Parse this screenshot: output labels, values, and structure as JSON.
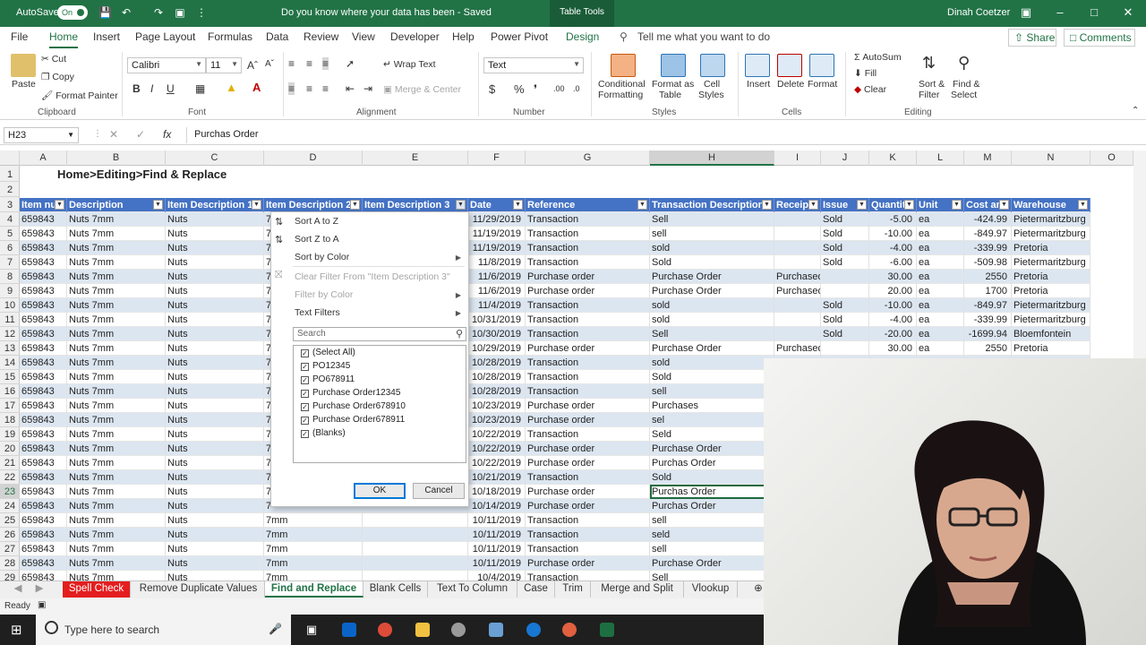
{
  "titlebar": {
    "autosave_label": "AutoSave",
    "autosave_state": "On",
    "doc_title": "Do you know where your data has been  -  Saved",
    "context_tab": "Table Tools",
    "user": "Dinah Coetzer"
  },
  "tabs": [
    "File",
    "Home",
    "Insert",
    "Page Layout",
    "Formulas",
    "Data",
    "Review",
    "View",
    "Developer",
    "Help",
    "Power Pivot",
    "Design"
  ],
  "tell_me": "Tell me what you want to do",
  "share_label": "Share",
  "comments_label": "Comments",
  "ribbon": {
    "clipboard": {
      "paste": "Paste",
      "cut": "Cut",
      "copy": "Copy",
      "format_painter": "Format Painter",
      "label": "Clipboard"
    },
    "font": {
      "name": "Calibri",
      "size": "11",
      "label": "Font"
    },
    "alignment": {
      "wrap": "Wrap Text",
      "merge": "Merge & Center",
      "label": "Alignment"
    },
    "number": {
      "format": "Text",
      "label": "Number"
    },
    "styles": {
      "conditional": "Conditional",
      "conditional2": "Formatting",
      "format_as": "Format as",
      "format_as2": "Table",
      "cell": "Cell",
      "cell2": "Styles",
      "label": "Styles"
    },
    "cells": {
      "insert": "Insert",
      "delete": "Delete",
      "format": "Format",
      "label": "Cells"
    },
    "editing": {
      "autosum": "AutoSum",
      "fill": "Fill",
      "clear": "Clear",
      "sort": "Sort &",
      "sort2": "Filter",
      "find": "Find &",
      "find2": "Select",
      "label": "Editing"
    }
  },
  "formula_bar": {
    "name_box": "H23",
    "value": "Purchas Order"
  },
  "columns": [
    "A",
    "B",
    "C",
    "D",
    "E",
    "F",
    "G",
    "H",
    "I",
    "J",
    "K",
    "L",
    "M",
    "N",
    "O"
  ],
  "page_title": "Home>Editing>Find & Replace",
  "table_headers": [
    "Item nu",
    "Description",
    "Item Description 1",
    "Item Description 2",
    "Item Description 3",
    "Date",
    "Reference",
    "Transaction Description",
    "Receipt",
    "Issue",
    "Quantit",
    "Unit",
    "Cost an",
    "Warehouse"
  ],
  "rows": [
    {
      "n": "4",
      "a": "659843",
      "b": "Nuts 7mm",
      "c": "Nuts",
      "d": "7",
      "f": "11/29/2019",
      "g": "Transaction",
      "h": "Sell",
      "i": "",
      "j": "Sold",
      "k": "-5.00",
      "l": "ea",
      "m": "-424.99",
      "wh": "Pietermaritzburg"
    },
    {
      "n": "5",
      "a": "659843",
      "b": "Nuts 7mm",
      "c": "Nuts",
      "d": "7",
      "f": "11/19/2019",
      "g": "Transaction",
      "h": "sell",
      "i": "",
      "j": "Sold",
      "k": "-10.00",
      "l": "ea",
      "m": "-849.97",
      "wh": "Pietermaritzburg"
    },
    {
      "n": "6",
      "a": "659843",
      "b": "Nuts 7mm",
      "c": "Nuts",
      "d": "7",
      "f": "11/19/2019",
      "g": "Transaction",
      "h": "sold",
      "i": "",
      "j": "Sold",
      "k": "-4.00",
      "l": "ea",
      "m": "-339.99",
      "wh": "Pretoria"
    },
    {
      "n": "7",
      "a": "659843",
      "b": "Nuts 7mm",
      "c": "Nuts",
      "d": "7",
      "f": "11/8/2019",
      "g": "Transaction",
      "h": "Sold",
      "i": "",
      "j": "Sold",
      "k": "-6.00",
      "l": "ea",
      "m": "-509.98",
      "wh": "Pietermaritzburg"
    },
    {
      "n": "8",
      "a": "659843",
      "b": "Nuts 7mm",
      "c": "Nuts",
      "d": "7",
      "f": "11/6/2019",
      "g": "Purchase order",
      "h": "Purchase Order",
      "i": "Purchased",
      "j": "",
      "k": "30.00",
      "l": "ea",
      "m": "2550",
      "wh": "Pretoria"
    },
    {
      "n": "9",
      "a": "659843",
      "b": "Nuts 7mm",
      "c": "Nuts",
      "d": "7",
      "f": "11/6/2019",
      "g": "Purchase order",
      "h": "Purchase Order",
      "i": "Purchased",
      "j": "",
      "k": "20.00",
      "l": "ea",
      "m": "1700",
      "wh": "Pretoria"
    },
    {
      "n": "10",
      "a": "659843",
      "b": "Nuts 7mm",
      "c": "Nuts",
      "d": "7",
      "f": "11/4/2019",
      "g": "Transaction",
      "h": "sold",
      "i": "",
      "j": "Sold",
      "k": "-10.00",
      "l": "ea",
      "m": "-849.97",
      "wh": "Pietermaritzburg"
    },
    {
      "n": "11",
      "a": "659843",
      "b": "Nuts 7mm",
      "c": "Nuts",
      "d": "7",
      "f": "10/31/2019",
      "g": "Transaction",
      "h": "sold",
      "i": "",
      "j": "Sold",
      "k": "-4.00",
      "l": "ea",
      "m": "-339.99",
      "wh": "Pietermaritzburg"
    },
    {
      "n": "12",
      "a": "659843",
      "b": "Nuts 7mm",
      "c": "Nuts",
      "d": "7",
      "f": "10/30/2019",
      "g": "Transaction",
      "h": "Sell",
      "i": "",
      "j": "Sold",
      "k": "-20.00",
      "l": "ea",
      "m": "-1699.94",
      "wh": "Bloemfontein"
    },
    {
      "n": "13",
      "a": "659843",
      "b": "Nuts 7mm",
      "c": "Nuts",
      "d": "7",
      "f": "10/29/2019",
      "g": "Purchase order",
      "h": "Purchase Order",
      "i": "Purchased",
      "j": "",
      "k": "30.00",
      "l": "ea",
      "m": "2550",
      "wh": "Pretoria"
    },
    {
      "n": "14",
      "a": "659843",
      "b": "Nuts 7mm",
      "c": "Nuts",
      "d": "7",
      "f": "10/28/2019",
      "g": "Transaction",
      "h": "sold",
      "i": "",
      "j": "",
      "k": "",
      "l": "",
      "m": "",
      "wh": ""
    },
    {
      "n": "15",
      "a": "659843",
      "b": "Nuts 7mm",
      "c": "Nuts",
      "d": "7",
      "f": "10/28/2019",
      "g": "Transaction",
      "h": "Sold",
      "i": "",
      "j": "",
      "k": "",
      "l": "",
      "m": "",
      "wh": ""
    },
    {
      "n": "16",
      "a": "659843",
      "b": "Nuts 7mm",
      "c": "Nuts",
      "d": "7",
      "f": "10/28/2019",
      "g": "Transaction",
      "h": "sell",
      "i": "",
      "j": "",
      "k": "",
      "l": "",
      "m": "",
      "wh": ""
    },
    {
      "n": "17",
      "a": "659843",
      "b": "Nuts 7mm",
      "c": "Nuts",
      "d": "7",
      "f": "10/23/2019",
      "g": "Purchase order",
      "h": "Purchases",
      "i": "",
      "j": "",
      "k": "",
      "l": "",
      "m": "",
      "wh": ""
    },
    {
      "n": "18",
      "a": "659843",
      "b": "Nuts 7mm",
      "c": "Nuts",
      "d": "7",
      "f": "10/23/2019",
      "g": "Purchase order",
      "h": "sel",
      "i": "",
      "j": "",
      "k": "",
      "l": "",
      "m": "",
      "wh": ""
    },
    {
      "n": "19",
      "a": "659843",
      "b": "Nuts 7mm",
      "c": "Nuts",
      "d": "7",
      "f": "10/22/2019",
      "g": "Transaction",
      "h": "Seld",
      "i": "",
      "j": "",
      "k": "",
      "l": "",
      "m": "",
      "wh": ""
    },
    {
      "n": "20",
      "a": "659843",
      "b": "Nuts 7mm",
      "c": "Nuts",
      "d": "7",
      "f": "10/22/2019",
      "g": "Purchase order",
      "h": "Purchase Order",
      "i": "",
      "j": "",
      "k": "",
      "l": "",
      "m": "",
      "wh": ""
    },
    {
      "n": "21",
      "a": "659843",
      "b": "Nuts 7mm",
      "c": "Nuts",
      "d": "7",
      "f": "10/22/2019",
      "g": "Purchase order",
      "h": "Purchas Order",
      "i": "",
      "j": "",
      "k": "",
      "l": "",
      "m": "",
      "wh": ""
    },
    {
      "n": "22",
      "a": "659843",
      "b": "Nuts 7mm",
      "c": "Nuts",
      "d": "7",
      "f": "10/21/2019",
      "g": "Transaction",
      "h": "Sold",
      "i": "",
      "j": "",
      "k": "",
      "l": "",
      "m": "",
      "wh": ""
    },
    {
      "n": "23",
      "a": "659843",
      "b": "Nuts 7mm",
      "c": "Nuts",
      "d": "7",
      "f": "10/18/2019",
      "g": "Purchase order",
      "h": "Purchas Order",
      "i": "",
      "j": "",
      "k": "",
      "l": "",
      "m": "",
      "wh": ""
    },
    {
      "n": "24",
      "a": "659843",
      "b": "Nuts 7mm",
      "c": "Nuts",
      "d": "7",
      "f": "10/14/2019",
      "g": "Purchase order",
      "h": "Purchas Order",
      "i": "",
      "j": "",
      "k": "",
      "l": "",
      "m": "",
      "wh": ""
    },
    {
      "n": "25",
      "a": "659843",
      "b": "Nuts 7mm",
      "c": "Nuts",
      "d": "7mm",
      "f": "10/11/2019",
      "g": "Transaction",
      "h": "sell",
      "i": "",
      "j": "",
      "k": "",
      "l": "",
      "m": "",
      "wh": ""
    },
    {
      "n": "26",
      "a": "659843",
      "b": "Nuts 7mm",
      "c": "Nuts",
      "d": "7mm",
      "f": "10/11/2019",
      "g": "Transaction",
      "h": "seld",
      "i": "",
      "j": "",
      "k": "",
      "l": "",
      "m": "",
      "wh": ""
    },
    {
      "n": "27",
      "a": "659843",
      "b": "Nuts 7mm",
      "c": "Nuts",
      "d": "7mm",
      "f": "10/11/2019",
      "g": "Transaction",
      "h": "sell",
      "i": "",
      "j": "",
      "k": "",
      "l": "",
      "m": "",
      "wh": ""
    },
    {
      "n": "28",
      "a": "659843",
      "b": "Nuts 7mm",
      "c": "Nuts",
      "d": "7mm",
      "f": "10/11/2019",
      "g": "Purchase order",
      "h": "Purchase Order",
      "i": "",
      "j": "",
      "k": "",
      "l": "",
      "m": "",
      "wh": ""
    },
    {
      "n": "29",
      "a": "659843",
      "b": "Nuts 7mm",
      "c": "Nuts",
      "d": "7mm",
      "f": "10/4/2019",
      "g": "Transaction",
      "h": "Sell",
      "i": "",
      "j": "",
      "k": "",
      "l": "",
      "m": "",
      "wh": ""
    }
  ],
  "filter": {
    "sort_az": "Sort A to Z",
    "sort_za": "Sort Z to A",
    "sort_color": "Sort by Color",
    "clear": "Clear Filter From \"Item Description 3\"",
    "filter_color": "Filter by Color",
    "text_filters": "Text Filters",
    "search_placeholder": "Search",
    "options": [
      "(Select All)",
      "PO12345",
      "PO678911",
      "Purchase Order12345",
      "Purchase Order678910",
      "Purchase Order678911",
      "(Blanks)"
    ],
    "ok": "OK",
    "cancel": "Cancel"
  },
  "sheets": [
    "Spell Check",
    "Remove Duplicate Values",
    "Find and Replace",
    "Blank Cells",
    "Text To Column",
    "Case",
    "Trim",
    "Merge and Split",
    "Vlookup"
  ],
  "active_sheet": "Find and Replace",
  "status": "Ready",
  "taskbar_search": "Type here to search"
}
